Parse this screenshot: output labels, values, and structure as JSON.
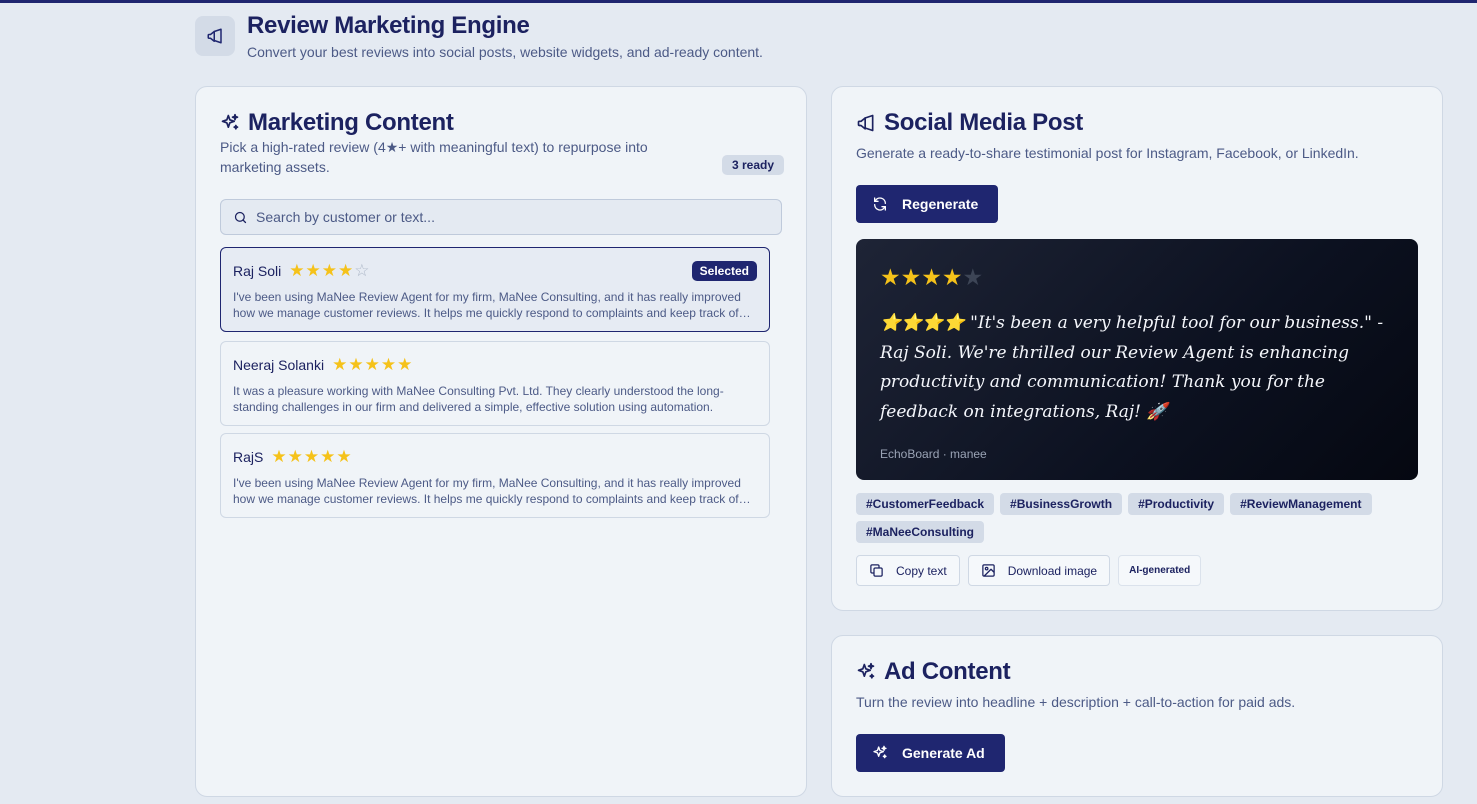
{
  "header": {
    "title": "Review Marketing Engine",
    "subtitle": "Convert your best reviews into social posts, website widgets, and ad-ready content."
  },
  "marketing": {
    "title": "Marketing Content",
    "description": "Pick a high-rated review (4★+ with meaningful text) to repurpose into marketing assets.",
    "ready_badge": "3 ready",
    "search_placeholder": "Search by customer or text...",
    "selected_label": "Selected",
    "reviews": [
      {
        "name": "Raj Soli",
        "rating": 4,
        "text": "I've been using MaNee Review Agent for my firm, MaNee Consulting, and it has really improved how we manage customer reviews. It helps me quickly respond to complaints and keep track of feedback.",
        "selected": true
      },
      {
        "name": "Neeraj Solanki",
        "rating": 5,
        "text": "It was a pleasure working with MaNee Consulting Pvt. Ltd. They clearly understood the long-standing challenges in our firm and delivered a simple, effective solution using automation.",
        "selected": false
      },
      {
        "name": "RajS",
        "rating": 5,
        "text": "I've been using MaNee Review Agent for my firm, MaNee Consulting, and it has really improved how we manage customer reviews. It helps me quickly respond to complaints and keep track of feedback.",
        "selected": false
      }
    ]
  },
  "social": {
    "title": "Social Media Post",
    "description": "Generate a ready-to-share testimonial post for Instagram, Facebook, or LinkedIn.",
    "regenerate_label": "Regenerate",
    "post": {
      "rating": 4,
      "text": "⭐⭐⭐⭐ \"It's been a very helpful tool for our business.\" - Raj Soli. We're thrilled our Review Agent is enhancing productivity and communication! Thank you for the feedback on integrations, Raj! 🚀",
      "source": "EchoBoard · manee"
    },
    "hashtags": [
      "#CustomerFeedback",
      "#BusinessGrowth",
      "#Productivity",
      "#ReviewManagement",
      "#MaNeeConsulting"
    ],
    "copy_label": "Copy text",
    "download_label": "Download image",
    "ai_label": "AI-generated"
  },
  "ad": {
    "title": "Ad Content",
    "description": "Turn the review into headline + description + call-to-action for paid ads.",
    "generate_label": "Generate Ad"
  },
  "colors": {
    "accent": "#1f2670",
    "star": "#f5c21a",
    "background": "#e4eaf2"
  }
}
